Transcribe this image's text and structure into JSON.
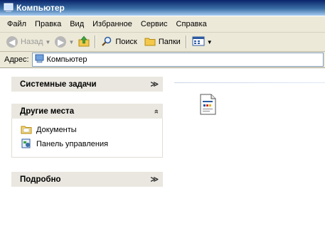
{
  "window": {
    "title": "Компьютер"
  },
  "menu": [
    "Файл",
    "Правка",
    "Вид",
    "Избранное",
    "Сервис",
    "Справка"
  ],
  "toolbar": {
    "back_label": "Назад",
    "search_label": "Поиск",
    "folders_label": "Папки"
  },
  "address": {
    "label": "Адрес:",
    "value": "Компьютер"
  },
  "panels": {
    "system": {
      "title": "Системные задачи"
    },
    "other": {
      "title": "Другие места",
      "items": [
        "Документы",
        "Панель управления"
      ]
    },
    "details": {
      "title": "Подробно"
    }
  }
}
